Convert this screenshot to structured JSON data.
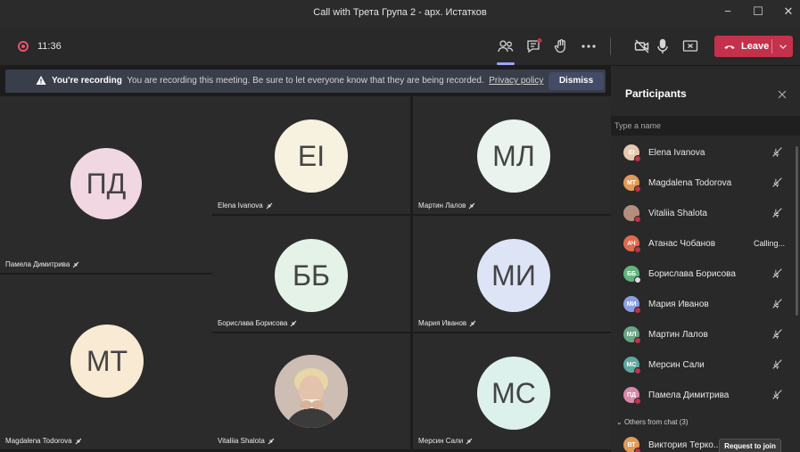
{
  "window": {
    "title": "Call with Трета Група 2 - арх. Истатков"
  },
  "toolbar": {
    "timer": "11:36",
    "leave_label": "Leave"
  },
  "banner": {
    "bold": "You're recording",
    "message": "You are recording this meeting. Be sure to let everyone know that they are being recorded.",
    "link": "Privacy policy",
    "dismiss_label": "Dismiss"
  },
  "tiles": [
    {
      "initials": "ПД",
      "name": "Памела Димитрива",
      "color": "#f0d7e2"
    },
    {
      "initials": "EI",
      "name": "Elena Ivanova",
      "color": "#f7f1e0"
    },
    {
      "initials": "МЛ",
      "name": "Мартин Лалов",
      "color": "#eaf3ee"
    },
    {
      "initials": "ББ",
      "name": "Борислава Борисова",
      "color": "#e4f2e8"
    },
    {
      "initials": "МИ",
      "name": "Мария Иванов",
      "color": "#dde4f6"
    },
    {
      "initials": "МТ",
      "name": "Magdalena Todorova",
      "color": "#f8ead3"
    },
    {
      "initials": "",
      "name": "Vitaliia Shalota",
      "color": "#d8c7bd"
    },
    {
      "initials": "МС",
      "name": "Мерсин Сали",
      "color": "#ddf1ec"
    }
  ],
  "panel": {
    "title": "Participants",
    "search_placeholder": "Type a name",
    "participants": [
      {
        "initials": "EI",
        "name": "Elena Ivanova",
        "status": "",
        "color": "#e8c9b1"
      },
      {
        "initials": "MT",
        "name": "Magdalena Todorova",
        "status": "",
        "color": "#e39a57"
      },
      {
        "initials": "",
        "name": "Vitaliia Shalota",
        "status": "",
        "color": "#b58d7b"
      },
      {
        "initials": "АЧ",
        "name": "Атанас Чобанов",
        "status": "Calling...",
        "color": "#e06a4f"
      },
      {
        "initials": "ББ",
        "name": "Борислава Борисова",
        "status": "",
        "color": "#63b37f"
      },
      {
        "initials": "МИ",
        "name": "Мария Иванов",
        "status": "",
        "color": "#8d9ee0"
      },
      {
        "initials": "МЛ",
        "name": "Мартин Лалов",
        "status": "",
        "color": "#6aa585"
      },
      {
        "initials": "МС",
        "name": "Мерсин Сали",
        "status": "",
        "color": "#5fa8a0"
      },
      {
        "initials": "ПД",
        "name": "Памела Димитрива",
        "status": "",
        "color": "#d987a8"
      }
    ],
    "others_header": "Others from chat (3)",
    "other": {
      "initials": "ВТ",
      "name": "Виктория Терко...",
      "color": "#e39a57"
    },
    "request_label": "Request to join"
  }
}
